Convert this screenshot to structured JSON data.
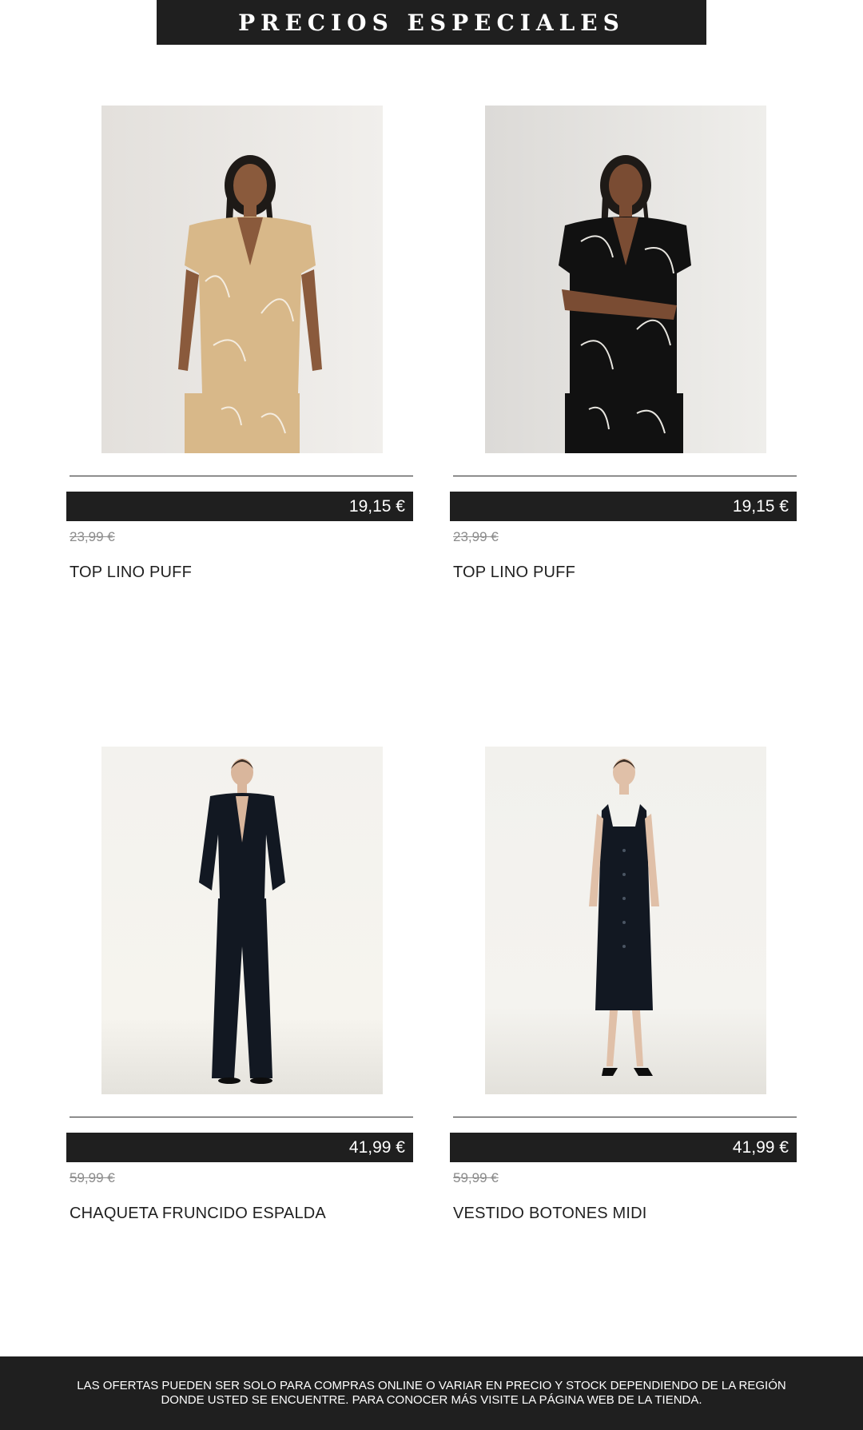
{
  "header": {
    "title": "PRECIOS ESPECIALES"
  },
  "products": [
    {
      "name": "TOP LINO PUFF",
      "price": "19,15 €",
      "old_price": "23,99 €",
      "garment_color": "#d8b889"
    },
    {
      "name": "TOP LINO PUFF",
      "price": "19,15 €",
      "old_price": "23,99 €",
      "garment_color": "#111111"
    },
    {
      "name": "CHAQUETA FRUNCIDO ESPALDA",
      "price": "41,99 €",
      "old_price": "59,99 €",
      "garment_color": "#121822"
    },
    {
      "name": "VESTIDO BOTONES MIDI",
      "price": "41,99 €",
      "old_price": "59,99 €",
      "garment_color": "#121822"
    }
  ],
  "footer": {
    "line1": "LAS OFERTAS PUEDEN SER SOLO PARA COMPRAS ONLINE O VARIAR EN PRECIO Y STOCK DEPENDIENDO DE LA REGIÓN",
    "line2": "DONDE USTED SE ENCUENTRE. PARA CONOCER MÁS VISITE LA PÁGINA WEB DE LA TIENDA."
  },
  "colors": {
    "banner": "#1f1f1f",
    "old_price": "#8b8b8b",
    "background": "#ffffff"
  }
}
